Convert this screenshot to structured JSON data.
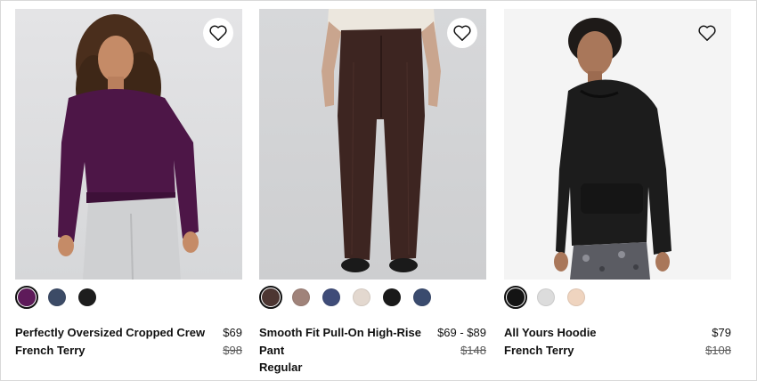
{
  "products": [
    {
      "name_lines": [
        "Perfectly Oversized Cropped Crew",
        "French Terry"
      ],
      "price": "$69",
      "original_price": "$98",
      "image_alt": "Woman wearing a plum oversized cropped crew sweatshirt",
      "swatches": [
        {
          "color": "#5e1a5a",
          "selected": true
        },
        {
          "color": "#3c4b66",
          "selected": false
        },
        {
          "color": "#1d1d1d",
          "selected": false
        }
      ]
    },
    {
      "name_lines": [
        "Smooth Fit Pull-On High-Rise",
        "Pant",
        "Regular"
      ],
      "price": "$69 - $89",
      "original_price": "$148",
      "image_alt": "Model wearing dark brown high-rise flared pants",
      "swatches": [
        {
          "color": "#4d3632",
          "selected": true
        },
        {
          "color": "#a0837a",
          "selected": false
        },
        {
          "color": "#3f4c78",
          "selected": false
        },
        {
          "color": "#e3d8cf",
          "selected": false
        },
        {
          "color": "#1a1a1a",
          "selected": false
        },
        {
          "color": "#3a4b6e",
          "selected": false
        }
      ]
    },
    {
      "name_lines": [
        "All Yours Hoodie",
        "French Terry"
      ],
      "price": "$79",
      "original_price": "$108",
      "image_alt": "Person wearing a black hoodie",
      "swatches": [
        {
          "color": "#141414",
          "selected": true
        },
        {
          "color": "#dcdcdc",
          "selected": false
        },
        {
          "color": "#efd4bf",
          "selected": false
        }
      ]
    }
  ],
  "icons": {
    "wishlist": "heart-outline-icon"
  }
}
